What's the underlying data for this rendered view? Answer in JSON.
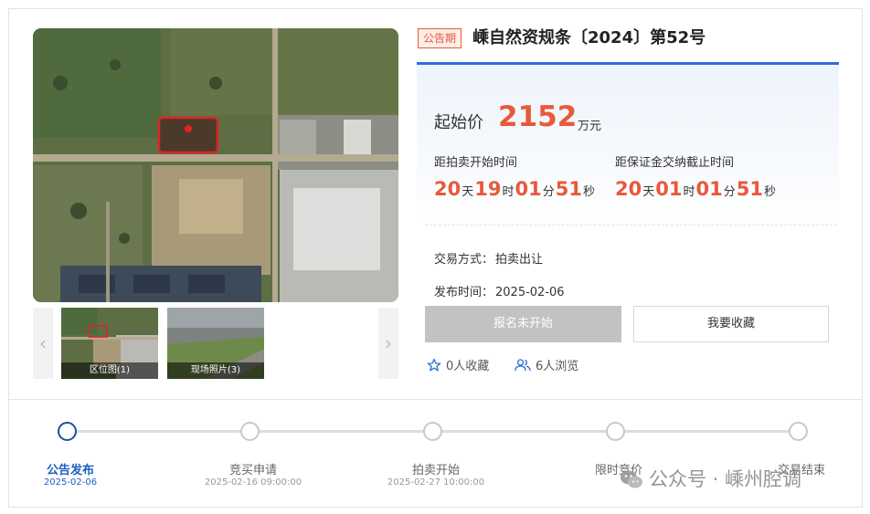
{
  "gallery": {
    "prev_arrow": "‹",
    "next_arrow": "›",
    "thumbnails": [
      {
        "caption": "区位图(1)"
      },
      {
        "caption": "现场照片(3)"
      }
    ]
  },
  "listing": {
    "badge": "公告期",
    "title": "嵊自然资规条〔2024〕第52号"
  },
  "price": {
    "label": "起始价",
    "value": "2152",
    "unit": "万元"
  },
  "countdowns": [
    {
      "label": "距拍卖开始时间",
      "days": "20",
      "hours": "19",
      "minutes": "01",
      "seconds": "51"
    },
    {
      "label": "距保证金交纳截止时间",
      "days": "20",
      "hours": "01",
      "minutes": "01",
      "seconds": "51"
    }
  ],
  "units": {
    "day": "天",
    "hour": "时",
    "minute": "分",
    "second": "秒"
  },
  "info": {
    "trade_method_label": "交易方式：",
    "trade_method_value": "拍卖出让",
    "publish_time_label": "发布时间：",
    "publish_time_value": "2025-02-06"
  },
  "actions": {
    "register_label": "报名未开始",
    "favorite_label": "我要收藏"
  },
  "stats": {
    "favorites": "0人收藏",
    "views": "6人浏览"
  },
  "timeline": [
    {
      "name": "公告发布",
      "date": "2025-02-06",
      "active": true
    },
    {
      "name": "竞买申请",
      "date": "2025-02-16 09:00:00",
      "active": false
    },
    {
      "name": "拍卖开始",
      "date": "2025-02-27 10:00:00",
      "active": false
    },
    {
      "name": "限时竞价",
      "date": "",
      "active": false
    },
    {
      "name": "交易结束",
      "date": "",
      "active": false
    }
  ],
  "watermark": "公众号 · 嵊州腔调",
  "colors": {
    "accent_orange": "#e8593a",
    "primary_blue": "#2b6fd6",
    "timeline_active": "#1d4fa3",
    "disabled_gray": "#c2c2c2"
  }
}
